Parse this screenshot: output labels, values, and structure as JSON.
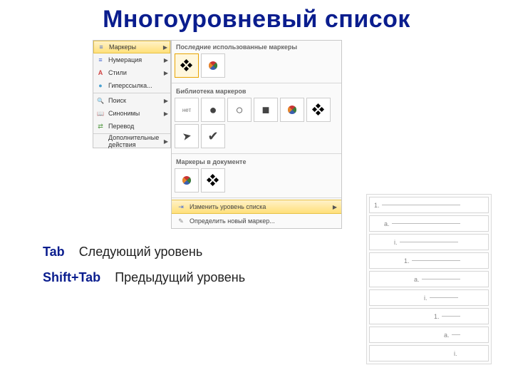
{
  "title": "Многоуровневый список",
  "context_menu": {
    "items": [
      {
        "label": "Маркеры",
        "icon": "ic-bullets",
        "selected": true,
        "arrow": true
      },
      {
        "label": "Нумерация",
        "icon": "ic-num",
        "selected": false,
        "arrow": true
      },
      {
        "label": "Стили",
        "icon": "ic-a",
        "selected": false,
        "arrow": true
      },
      {
        "label": "Гиперссылка...",
        "icon": "ic-world",
        "selected": false,
        "arrow": false
      },
      {
        "label": "Поиск",
        "icon": "ic-search",
        "selected": false,
        "arrow": true
      },
      {
        "label": "Синонимы",
        "icon": "ic-book",
        "selected": false,
        "arrow": true
      },
      {
        "label": "Перевод",
        "icon": "ic-trans",
        "selected": false,
        "arrow": false
      },
      {
        "label": "Дополнительные действия",
        "icon": "",
        "selected": false,
        "arrow": true
      }
    ]
  },
  "gallery": {
    "section_recent": "Последние использованные маркеры",
    "recent": [
      "four-diamond",
      "color-bullet"
    ],
    "section_library": "Библиотека маркеров",
    "library": [
      "нет",
      "●",
      "○",
      "■",
      "color-bullet",
      "four-diamond",
      "plane",
      "✔"
    ],
    "section_doc": "Маркеры в документе",
    "in_doc": [
      "color-bullet",
      "four-diamond"
    ],
    "footer_change": "Изменить уровень списка",
    "footer_define": "Определить новый маркер..."
  },
  "levels": [
    {
      "prefix": "1.",
      "indent": 0
    },
    {
      "prefix": "a.",
      "indent": 14
    },
    {
      "prefix": "i.",
      "indent": 28
    },
    {
      "prefix": "1.",
      "indent": 42
    },
    {
      "prefix": "a.",
      "indent": 56
    },
    {
      "prefix": "i.",
      "indent": 70
    },
    {
      "prefix": "1.",
      "indent": 84
    },
    {
      "prefix": "a.",
      "indent": 98
    },
    {
      "prefix": "i.",
      "indent": 112
    }
  ],
  "hints": {
    "tab_key": "Tab",
    "tab_desc": "Следующий уровень",
    "shift_key": "Shift+Tab",
    "shift_desc": "Предыдущий уровень"
  }
}
